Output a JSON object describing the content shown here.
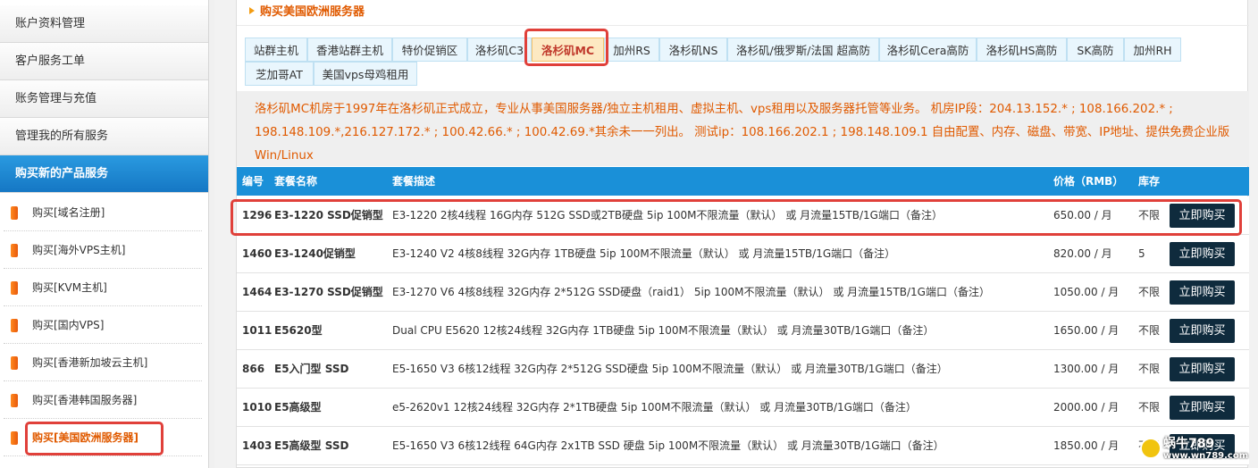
{
  "sidebar": {
    "menu": [
      {
        "label": "账户资料管理"
      },
      {
        "label": "客户服务工单"
      },
      {
        "label": "账务管理与充值"
      },
      {
        "label": "管理我的所有服务"
      },
      {
        "label": "购买新的产品服务"
      }
    ],
    "sub_items": [
      {
        "label": "购买[域名注册]"
      },
      {
        "label": "购买[海外VPS主机]"
      },
      {
        "label": "购买[KVM主机]"
      },
      {
        "label": "购买[国内VPS]"
      },
      {
        "label": "购买[香港新加坡云主机]"
      },
      {
        "label": "购买[香港韩国服务器]"
      },
      {
        "label": "购买[美国欧洲服务器]"
      }
    ]
  },
  "main": {
    "title": "购买美国欧洲服务器",
    "tabs": [
      {
        "label": "站群主机"
      },
      {
        "label": "香港站群主机"
      },
      {
        "label": "特价促销区"
      },
      {
        "label": "洛杉矶C3"
      },
      {
        "label": "洛杉矶MC"
      },
      {
        "label": "加州RS"
      },
      {
        "label": "洛杉矶NS"
      },
      {
        "label": "洛杉矶/俄罗斯/法国 超高防"
      },
      {
        "label": "洛杉矶Cera高防"
      },
      {
        "label": "洛杉矶HS高防"
      },
      {
        "label": "SK高防"
      },
      {
        "label": "加州RH"
      },
      {
        "label": "芝加哥AT"
      },
      {
        "label": "美国vps母鸡租用"
      }
    ],
    "active_tab": "洛杉矶MC",
    "description": "洛杉矶MC机房于1997年在洛杉矶正式成立，专业从事美国服务器/独立主机租用、虚拟主机、vps租用以及服务器托管等业务。 机房IP段：204.13.152.* ; 108.166.202.* ; 198.148.109.*,216.127.172.* ; 100.42.66.* ; 100.42.69.*其余未一一列出。 测试ip：108.166.202.1 ; 198.148.109.1 自由配置、内存、磁盘、带宽、IP地址、提供免费企业版Win/Linux"
  },
  "table": {
    "headers": {
      "id": "编号",
      "name": "套餐名称",
      "desc": "套餐描述",
      "price": "价格（RMB）",
      "stock": "库存"
    },
    "buy_label": "立即购买",
    "rows": [
      {
        "id": "1296",
        "name": "E3-1220 SSD促销型",
        "desc": "E3-1220 2核4线程 16G内存 512G SSD或2TB硬盘  5ip  100M不限流量（默认） 或  月流量15TB/1G端口（备注）",
        "price": "650.00 / 月",
        "stock": "不限"
      },
      {
        "id": "1460",
        "name": "E3-1240促销型",
        "desc": "E3-1240 V2 4核8线程 32G内存 1TB硬盘  5ip 100M不限流量（默认） 或  月流量15TB/1G端口（备注）",
        "price": "820.00 / 月",
        "stock": "5"
      },
      {
        "id": "1464",
        "name": "E3-1270 SSD促销型",
        "desc": "E3-1270 V6 4核8线程 32G内存 2*512G SSD硬盘（raid1） 5ip 100M不限流量（默认） 或  月流量15TB/1G端口（备注）",
        "price": "1050.00 / 月",
        "stock": "不限"
      },
      {
        "id": "1011",
        "name": "E5620型",
        "desc": "Dual CPU E5620 12核24线程 32G内存 1TB硬盘 5ip 100M不限流量（默认） 或  月流量30TB/1G端口（备注）",
        "price": "1650.00 / 月",
        "stock": "不限"
      },
      {
        "id": "866",
        "name": "E5入门型 SSD",
        "desc": "E5-1650 V3 6核12线程 32G内存 2*512G SSD硬盘 5ip 100M不限流量（默认） 或  月流量30TB/1G端口（备注）",
        "price": "1300.00 / 月",
        "stock": "不限"
      },
      {
        "id": "1010",
        "name": "E5高级型",
        "desc": "e5-2620v1 12核24线程 32G内存 2*1TB硬盘 5ip 100M不限流量（默认） 或  月流量30TB/1G端口（备注）",
        "price": "2000.00 / 月",
        "stock": "不限"
      },
      {
        "id": "1403",
        "name": "E5高级型 SSD",
        "desc": "E5-1650 V3 6核12线程 64G内存 2x1TB SSD 硬盘 5ip 100M不限流量（默认） 或  月流量30TB/1G端口（备注）",
        "price": "1850.00 / 月",
        "stock": "不限"
      }
    ]
  },
  "watermark": {
    "line1": "蜗牛789",
    "line2": "www.wn789.com"
  },
  "colors": {
    "accent_orange": "#e05a00",
    "header_blue": "#1a90d8",
    "buy_button": "#0f2b3d",
    "annotation_red": "#e0403a"
  }
}
